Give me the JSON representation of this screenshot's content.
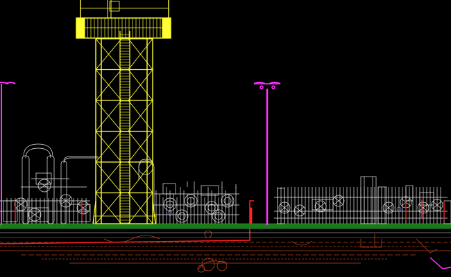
{
  "drawing": {
    "background_color": "#000000",
    "colors": {
      "tower": "#ffff33",
      "lamp_post": "#ff33ff",
      "equipment": "#e8e8e8",
      "ground_slab": "#1a7a1a",
      "underground": "#b8431e",
      "pipe_red": "#ff2020",
      "accent_blue": "#8899ff"
    },
    "elements": {
      "tower": "lattice-tower",
      "lamp_posts": [
        "light-pole-left",
        "light-pole-center"
      ],
      "process_units": [
        "left-process-unit",
        "center-process-unit",
        "right-process-unit"
      ],
      "ground": "ground-slab",
      "below_grade": "underground-piping"
    }
  }
}
